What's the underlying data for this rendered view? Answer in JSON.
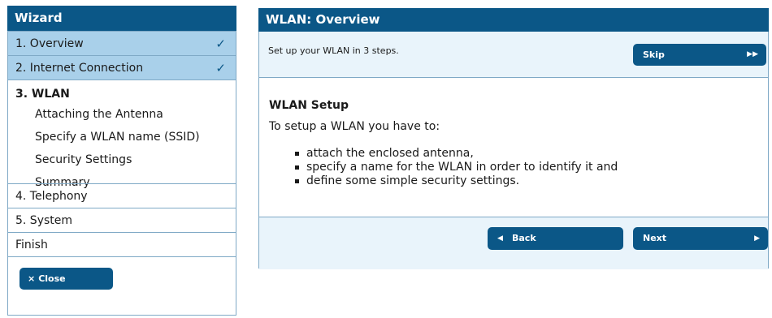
{
  "wizard": {
    "title": "Wizard",
    "steps_done": [
      {
        "label": "1. Overview",
        "check": "✓"
      },
      {
        "label": "2. Internet Connection",
        "check": "✓"
      }
    ],
    "current": {
      "label": "3. WLAN",
      "substeps": [
        "Attaching the Antenna",
        "Specify a WLAN name (SSID)",
        "Security Settings",
        "Summary"
      ]
    },
    "steps_pending": [
      "4. Telephony",
      "5. System",
      "Finish"
    ],
    "close_label": "Close",
    "close_icon": "×"
  },
  "panel": {
    "title": "WLAN: Overview",
    "intro": "Set up your WLAN in 3 steps.",
    "skip_label": "Skip",
    "skip_icon": "▶▶",
    "heading": "WLAN Setup",
    "lead": "To setup a WLAN you have to:",
    "bullets": [
      "attach the enclosed antenna,",
      "specify a name for the WLAN in order to identify it and",
      "define some simple security settings."
    ],
    "back_label": "Back",
    "back_icon": "◀",
    "next_label": "Next",
    "next_icon": "▶"
  },
  "colors": {
    "header_blue": "#0b5787",
    "done_step_bg": "#a9d0ea",
    "bar_bg": "#e9f4fb",
    "border": "#7fa9c6"
  }
}
